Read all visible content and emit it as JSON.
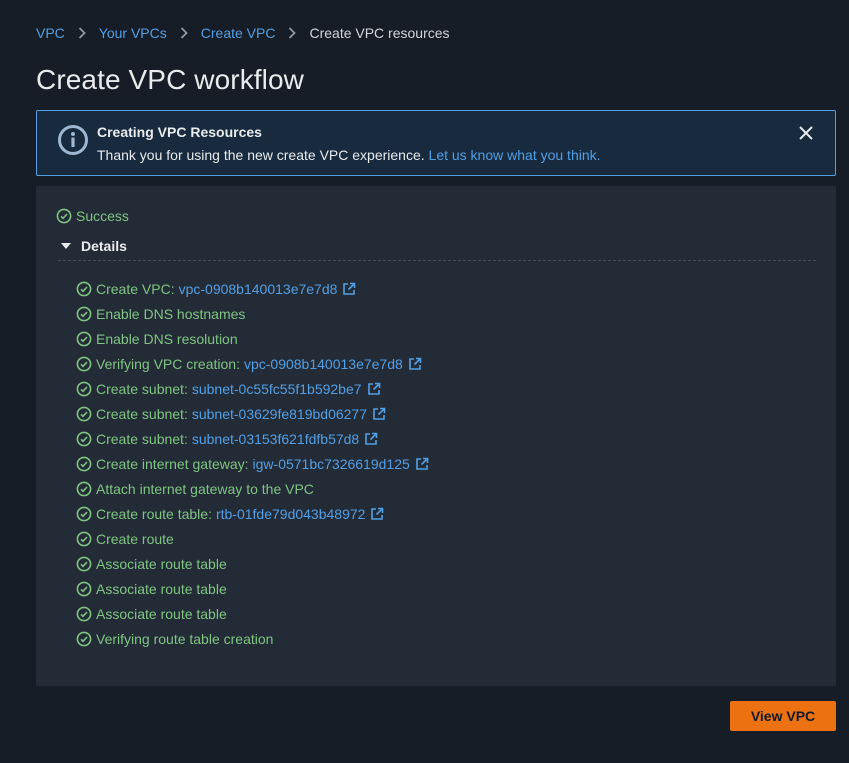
{
  "breadcrumb": {
    "items": [
      {
        "label": "VPC"
      },
      {
        "label": "Your VPCs"
      },
      {
        "label": "Create VPC"
      },
      {
        "label": "Create VPC resources"
      }
    ]
  },
  "page": {
    "title": "Create VPC workflow"
  },
  "flash": {
    "icon": "info-circle-icon",
    "title": "Creating VPC Resources",
    "body": "Thank you for using the new create VPC experience.",
    "link": "Let us know what you think.",
    "close_icon": "close-icon"
  },
  "status": {
    "label": "Success"
  },
  "details": {
    "header": "Details",
    "steps": [
      {
        "label": "Create VPC:",
        "resource": "vpc-0908b140013e7e7d8"
      },
      {
        "label": "Enable DNS hostnames"
      },
      {
        "label": "Enable DNS resolution"
      },
      {
        "label": "Verifying VPC creation:",
        "resource": "vpc-0908b140013e7e7d8"
      },
      {
        "label": "Create subnet:",
        "resource": "subnet-0c55fc55f1b592be7"
      },
      {
        "label": "Create subnet:",
        "resource": "subnet-03629fe819bd06277"
      },
      {
        "label": "Create subnet:",
        "resource": "subnet-03153f621fdfb57d8"
      },
      {
        "label": "Create internet gateway:",
        "resource": "igw-0571bc7326619d125"
      },
      {
        "label": "Attach internet gateway to the VPC"
      },
      {
        "label": "Create route table:",
        "resource": "rtb-01fde79d043b48972"
      },
      {
        "label": "Create route"
      },
      {
        "label": "Associate route table"
      },
      {
        "label": "Associate route table"
      },
      {
        "label": "Associate route table"
      },
      {
        "label": "Verifying route table creation"
      }
    ]
  },
  "actions": {
    "view_vpc": "View VPC"
  },
  "colors": {
    "background": "#161d26",
    "panel": "#232b37",
    "link": "#539fe5",
    "success": "#7fc581",
    "info_border": "#539fe5",
    "primary_button": "#ec7211"
  }
}
